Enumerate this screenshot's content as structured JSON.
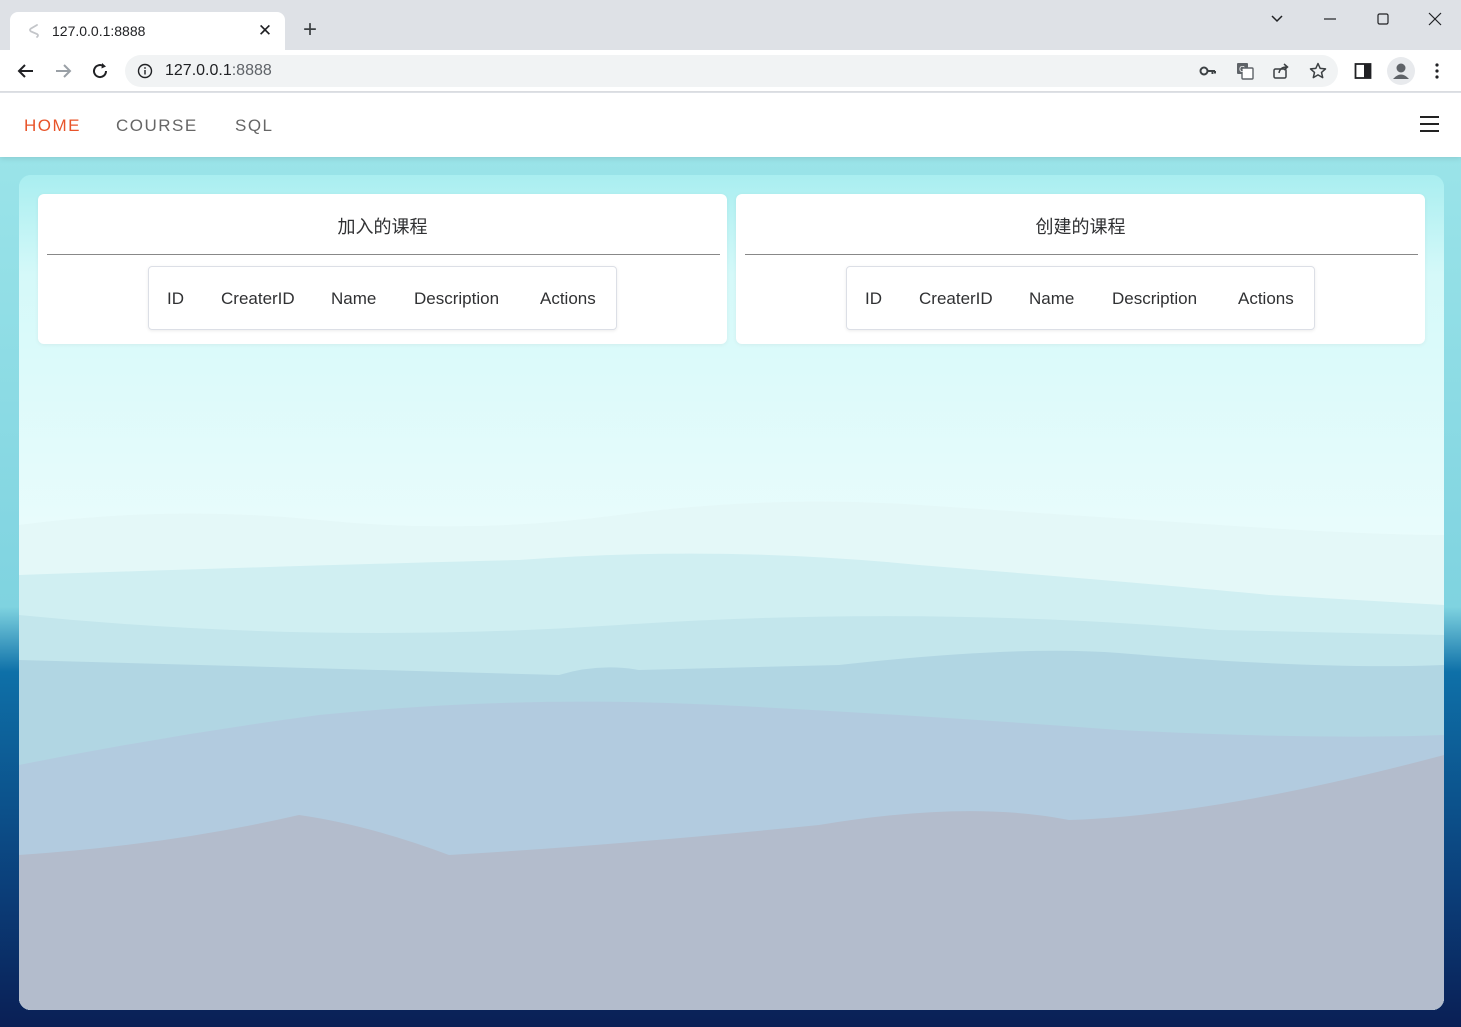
{
  "browser": {
    "tab_title": "127.0.0.1:8888",
    "url_host": "127.0.0.1",
    "url_port": ":8888"
  },
  "nav": {
    "links": [
      "HOME",
      "COURSE",
      "SQL"
    ],
    "active": "HOME",
    "accent": "#e8542a"
  },
  "panels": [
    {
      "title": "加入的课程",
      "columns": [
        "ID",
        "CreaterID",
        "Name",
        "Description",
        "Actions"
      ],
      "rows": []
    },
    {
      "title": "创建的课程",
      "columns": [
        "ID",
        "CreaterID",
        "Name",
        "Description",
        "Actions"
      ],
      "rows": []
    }
  ]
}
